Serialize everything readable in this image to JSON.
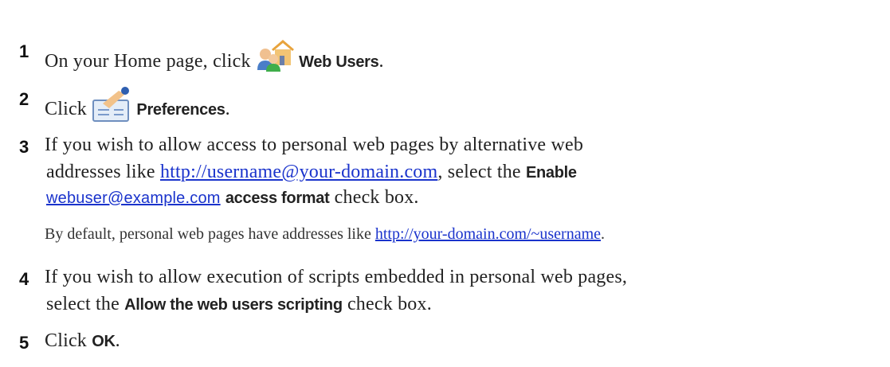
{
  "steps": [
    {
      "num": "1",
      "pre": "On your Home page, click",
      "bold": "Web Users",
      "post": ".",
      "icon": "web-users-icon"
    },
    {
      "num": "2",
      "pre": "Click",
      "bold": "Preferences",
      "post": ".",
      "icon": "preferences-icon"
    },
    {
      "num": "3",
      "line1": "If you wish to allow access to personal web pages by alternative web",
      "line2_pre": "addresses like",
      "line2_link": "http://username@your-domain.com",
      "line2_mid": ", select the",
      "line2_bold": "Enable",
      "line3_link": "webuser@example.com",
      "line3_bold": "access format",
      "line3_post": "check box.",
      "note_pre": "By default, personal web pages have addresses like",
      "note_link": "http://your-domain.com/~username",
      "note_post": "."
    },
    {
      "num": "4",
      "line1": "If you wish to allow execution of scripts embedded in personal web pages,",
      "line2_pre": "select the",
      "line2_bold": "Allow the web users scripting",
      "line2_post": "check box."
    },
    {
      "num": "5",
      "pre": "Click",
      "bold": "OK",
      "post": "."
    }
  ]
}
